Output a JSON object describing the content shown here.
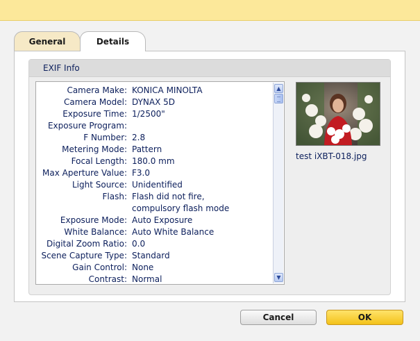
{
  "tabs": {
    "general": "General",
    "details": "Details"
  },
  "exif": {
    "header": "EXIF Info",
    "rows": [
      {
        "k": "Camera Make:",
        "v": "KONICA MINOLTA"
      },
      {
        "k": "Camera Model:",
        "v": "DYNAX 5D"
      },
      {
        "k": "Exposure Time:",
        "v": "1/2500\""
      },
      {
        "k": "Exposure Program:",
        "v": ""
      },
      {
        "k": "F Number:",
        "v": "2.8"
      },
      {
        "k": "Metering Mode:",
        "v": "Pattern"
      },
      {
        "k": "Focal Length:",
        "v": "180.0 mm"
      },
      {
        "k": "Max Aperture Value:",
        "v": "F3.0"
      },
      {
        "k": "Light Source:",
        "v": "Unidentified"
      },
      {
        "k": "Flash:",
        "v": "Flash did not fire,"
      },
      {
        "k": "",
        "v": "compulsory flash mode"
      },
      {
        "k": "Exposure Mode:",
        "v": "Auto Exposure"
      },
      {
        "k": "White Balance:",
        "v": "Auto White Balance"
      },
      {
        "k": "Digital Zoom Ratio:",
        "v": "0.0"
      },
      {
        "k": "Scene Capture Type:",
        "v": "Standard"
      },
      {
        "k": "Gain Control:",
        "v": "None"
      },
      {
        "k": "Contrast:",
        "v": "Normal"
      }
    ]
  },
  "preview": {
    "filename": "test iXBT-018.jpg"
  },
  "buttons": {
    "cancel": "Cancel",
    "ok": "OK"
  },
  "icons": {
    "scroll_up": "chevron-up-icon",
    "scroll_down": "chevron-down-icon"
  },
  "colors": {
    "titlebar": "#fce89a",
    "ok_button": "#f7cf2e",
    "text": "#0b1e5b"
  }
}
